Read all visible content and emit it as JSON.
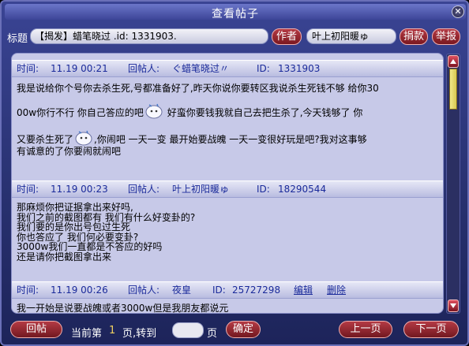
{
  "window": {
    "title": "查看帖子",
    "close_glyph": "✕"
  },
  "header": {
    "subject_label": "标题",
    "subject_value": "【揭发】蜡笔晓过 .id: 1331903.",
    "author_button": "作者",
    "author_value": "叶上初阳暖ゅ",
    "donate_button": "捐款",
    "report_button": "举报"
  },
  "posts": [
    {
      "time_label": "时间:",
      "time": "11.19 00:21",
      "poster_label": "回帖人:",
      "poster": "ぐ蜡笔晓过〃",
      "id_label": "ID:",
      "id": "1331903",
      "lines": [
        "我是说给你个号你去杀生死,号都准备好了,昨天你说你要转区我说杀生死钱不够 给你30",
        "00w你行不行 你自己答应的吧",
        " 好蛮你要钱我就自己去把生杀了,今天钱够了 你",
        "又要杀生死了",
        ",你闹吧 一天一变  最开始要战魄 一天一变很好玩是吧?我对这事够",
        "有诚意的了你要闹就闹吧"
      ]
    },
    {
      "time_label": "时间:",
      "time": "11.19 00:23",
      "poster_label": "回帖人:",
      "poster": "叶上初阳暖ゅ",
      "id_label": "ID:",
      "id": "18290544",
      "lines": [
        "那麻烦你把证据拿出来好吗,",
        "我们之前的截图都有 我们有什么好变卦的?",
        "我们要的是你出号包过生死",
        "你也答应了 我们何必要变卦?",
        "3000w我们一直都是不答应的好吗",
        "还是请你把截图拿出来"
      ]
    },
    {
      "time_label": "时间:",
      "time": "11.19 00:26",
      "poster_label": "回帖人:",
      "poster": "夜皇",
      "id_label": "ID:",
      "id": "25727298",
      "edit_link": "编辑",
      "delete_link": "删除",
      "lines": [
        "我一开始是说要战魄或者3000w但是我朋友都说元"
      ]
    }
  ],
  "footer": {
    "back_button": "回帖",
    "current_label": "当前第",
    "current_page": "1",
    "page_goto": "页,转到",
    "page_suffix": "页",
    "confirm_button": "确定",
    "prev_button": "上一页",
    "next_button": "下一页"
  },
  "colors": {
    "window_bg": "#27306e",
    "panel_bg": "#c7c9e8",
    "post_header_text": "#1a2a9a",
    "button_red": "#8c2430"
  }
}
